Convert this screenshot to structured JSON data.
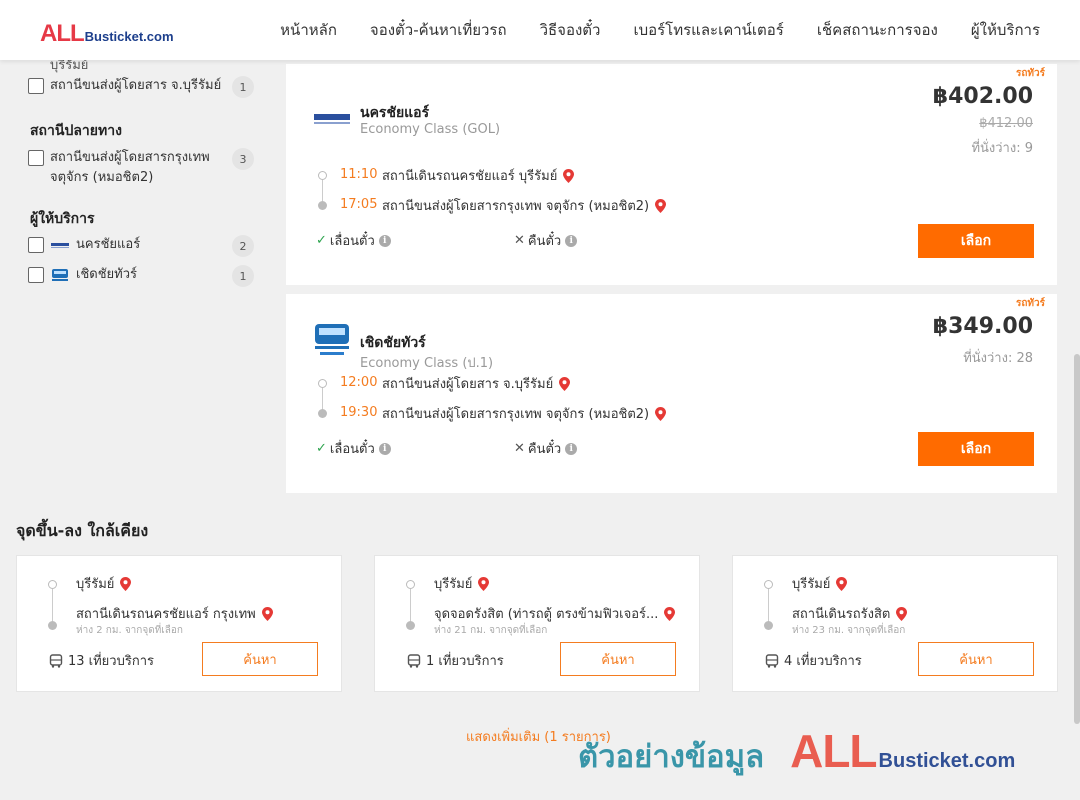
{
  "header": {
    "logo_all": "ALL",
    "logo_bt": "Busticket.com",
    "nav": [
      "หน้าหลัก",
      "จองตั๋ว-ค้นหาเที่ยวรถ",
      "วิธีจองตั๋ว",
      "เบอร์โทรและเคาน์เตอร์",
      "เช็คสถานะการจอง",
      "ผู้ให้บริการ"
    ]
  },
  "sidebar": {
    "clipped_text": "บุรีรัมย์",
    "origin_items": [
      {
        "label": "สถานีขนส่งผู้โดยสาร จ.บุรีรัมย์",
        "count": "1"
      }
    ],
    "destination_title": "สถานีปลายทาง",
    "destination_items": [
      {
        "label": "สถานีขนส่งผู้โดยสารกรุงเทพ จตุจักร (หมอชิต2)",
        "count": "3"
      }
    ],
    "operator_title": "ผู้ให้บริการ",
    "operator_items": [
      {
        "label": "นครชัยแอร์",
        "count": "2",
        "icon": "nakhonchai-logo"
      },
      {
        "label": "เชิดชัยทัวร์",
        "count": "1",
        "icon": "cherdchai-logo"
      }
    ]
  },
  "trips": [
    {
      "tag": "รถทัวร์",
      "operator": "นครชัยแอร์",
      "class": "Economy Class (GOL)",
      "price": "฿402.00",
      "old_price": "฿412.00",
      "seats": "ที่นั่งว่าง: 9",
      "depart_time": "11:10",
      "depart_station": "สถานีเดินรถนครชัยแอร์ บุรีรัมย์",
      "arrive_time": "17:05",
      "arrive_station": "สถานีขนส่งผู้โดยสารกรุงเทพ จตุจักร (หมอชิต2)",
      "feature_ok": "เลื่อนตั๋ว",
      "feature_no": "คืนตั๋ว",
      "button": "เลือก"
    },
    {
      "tag": "รถทัวร์",
      "operator": "เชิดชัยทัวร์",
      "class": "Economy Class (ป.1)",
      "price": "฿349.00",
      "old_price": "",
      "seats": "ที่นั่งว่าง: 28",
      "depart_time": "12:00",
      "depart_station": "สถานีขนส่งผู้โดยสาร จ.บุรีรัมย์",
      "arrive_time": "19:30",
      "arrive_station": "สถานีขนส่งผู้โดยสารกรุงเทพ จตุจักร (หมอชิต2)",
      "feature_ok": "เลื่อนตั๋ว",
      "feature_no": "คืนตั๋ว",
      "button": "เลือก"
    }
  ],
  "nearby": {
    "title": "จุดขึ้น-ลง ใกล้เคียง",
    "cards": [
      {
        "from": "บุรีรัมย์",
        "to": "สถานีเดินรถนครชัยแอร์ กรุงเทพ",
        "distance": "ห่าง 2 กม. จากจุดที่เลือก",
        "services": "13 เที่ยวบริการ",
        "button": "ค้นหา"
      },
      {
        "from": "บุรีรัมย์",
        "to": "จุดจอดรังสิต (ท่ารถตู้ ตรงข้ามฟิวเจอร์...",
        "distance": "ห่าง 21 กม. จากจุดที่เลือก",
        "services": "1 เที่ยวบริการ",
        "button": "ค้นหา"
      },
      {
        "from": "บุรีรัมย์",
        "to": "สถานีเดินรถรังสิต",
        "distance": "ห่าง 23 กม. จากจุดที่เลือก",
        "services": "4 เที่ยวบริการ",
        "button": "ค้นหา"
      }
    ],
    "show_more": "แสดงเพิ่มเติม (1 รายการ)"
  },
  "watermark": {
    "thai": "ตัวอย่างข้อมูล",
    "all": "ALL",
    "bt": "Busticket.com"
  },
  "colors": {
    "accent": "#ff6b00",
    "accent_text": "#f47c20",
    "logo_red": "#e63946",
    "logo_blue": "#1d3f8c"
  }
}
